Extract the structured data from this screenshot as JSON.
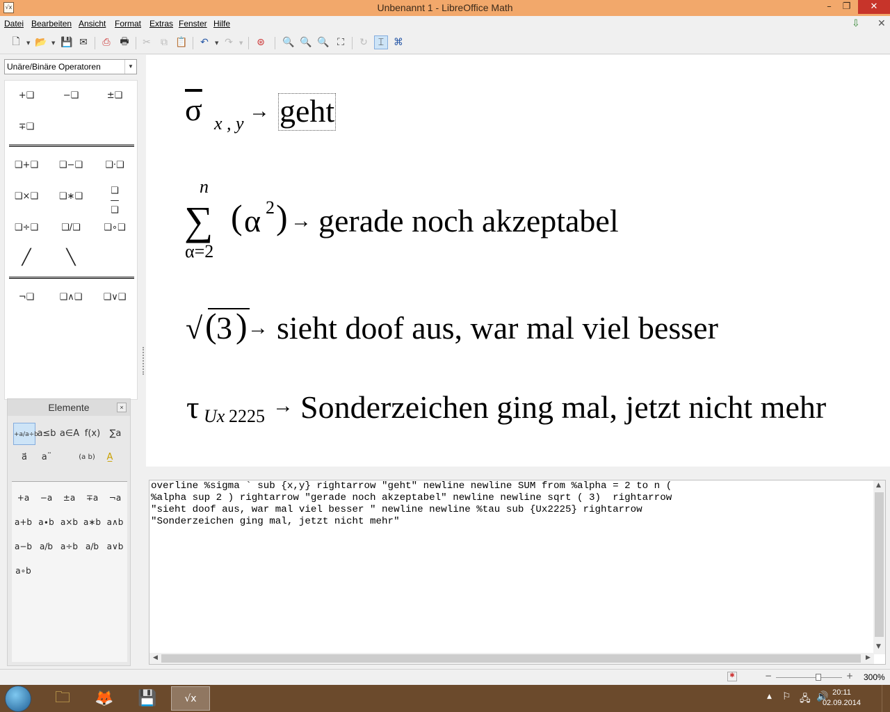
{
  "window": {
    "title": "Unbenannt 1 - LibreOffice Math",
    "minimize_glyph": "–",
    "maximize_glyph": "❐",
    "close_glyph": "✕"
  },
  "menu": [
    "Datei",
    "Bearbeiten",
    "Ansicht",
    "Format",
    "Extras",
    "Fenster",
    "Hilfe"
  ],
  "category_select": {
    "value": "Unäre/Binäre Operatoren"
  },
  "symbols": {
    "unary": [
      "+❑",
      "−❑",
      "±❑",
      "∓❑"
    ],
    "binary": [
      "❑+❑",
      "❑−❑",
      "❑·❑",
      "❑×❑",
      "❑∗❑",
      "❑÷❑",
      "❑/❑",
      "❑∘❑"
    ],
    "logic": [
      "¬❑",
      "❑∧❑",
      "❑∨❑"
    ]
  },
  "elements_panel": {
    "title": "Elemente",
    "close_label": "×",
    "categories_row1": [
      "+a/a÷b",
      "a≤b",
      "a∈A",
      "f(x)",
      "∑a"
    ],
    "categories_row2": [
      "a⃗",
      "a¨",
      "(a b)",
      "A̲"
    ],
    "items": [
      "+a",
      "−a",
      "±a",
      "∓a",
      "¬a",
      "a+b",
      "a∙b",
      "a×b",
      "a∗b",
      "a∧b",
      "a−b",
      "a/b",
      "a÷b",
      "a/b",
      "a∨b",
      "a∘b"
    ]
  },
  "formula": {
    "line1": {
      "symbol": "σ",
      "subscript": "x , y",
      "arrow": "→",
      "text": "geht"
    },
    "line2": {
      "upper": "n",
      "sum": "∑",
      "lower": "α=2",
      "open": "(",
      "alpha": "α",
      "exponent": "2",
      "close": ")",
      "arrow": "→",
      "text": "gerade noch akzeptabel"
    },
    "line3": {
      "sqrt": "√",
      "open": "(",
      "value": "3",
      "close": ")",
      "arrow": "→",
      "text": "sieht doof aus, war mal viel besser"
    },
    "line4": {
      "symbol": "τ",
      "subscript_italic": "Ux",
      "subscript_num": "2225",
      "arrow": "→",
      "text": "Sonderzeichen ging mal, jetzt nicht mehr"
    }
  },
  "command_text": "overline %sigma ` sub {x,y} rightarrow \"geht\" newline newline SUM from %alpha = 2 to n (\n%alpha sup 2 ) rightarrow \"gerade noch akzeptabel\" newline newline sqrt ( 3)  rightarrow\n\"sieht doof aus, war mal viel besser \" newline newline %tau sub {Ux2225} rightarrow\n\"Sonderzeichen ging mal, jetzt nicht mehr\"",
  "status": {
    "zoom": "300%"
  },
  "taskbar": {
    "time": "20:11",
    "date": "02.09.2014"
  },
  "colors": {
    "titlebar": "#f2a86b",
    "taskbar": "#6b4a2c",
    "close": "#c7342a"
  }
}
